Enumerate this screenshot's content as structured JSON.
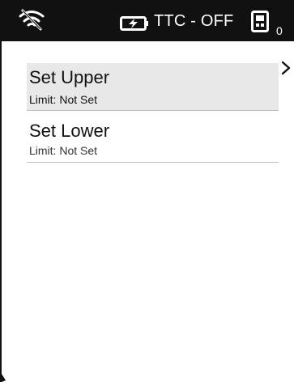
{
  "status_bar": {
    "wifi_icon": "wifi-off-icon",
    "battery_icon": "battery-charging-icon",
    "ttc_status": "TTC - OFF",
    "device_icon": "device-icon",
    "count": "0"
  },
  "menu": {
    "items": [
      {
        "title": "Set Upper",
        "subtitle": "Limit: Not Set",
        "selected": true
      },
      {
        "title": "Set Lower",
        "subtitle": "Limit: Not Set",
        "selected": false
      }
    ],
    "chevron_icon": "chevron-right-icon"
  },
  "colors": {
    "status_bar_bg": "#111111",
    "selected_bg": "#e8e8e8",
    "divider": "#bdbdbd"
  }
}
